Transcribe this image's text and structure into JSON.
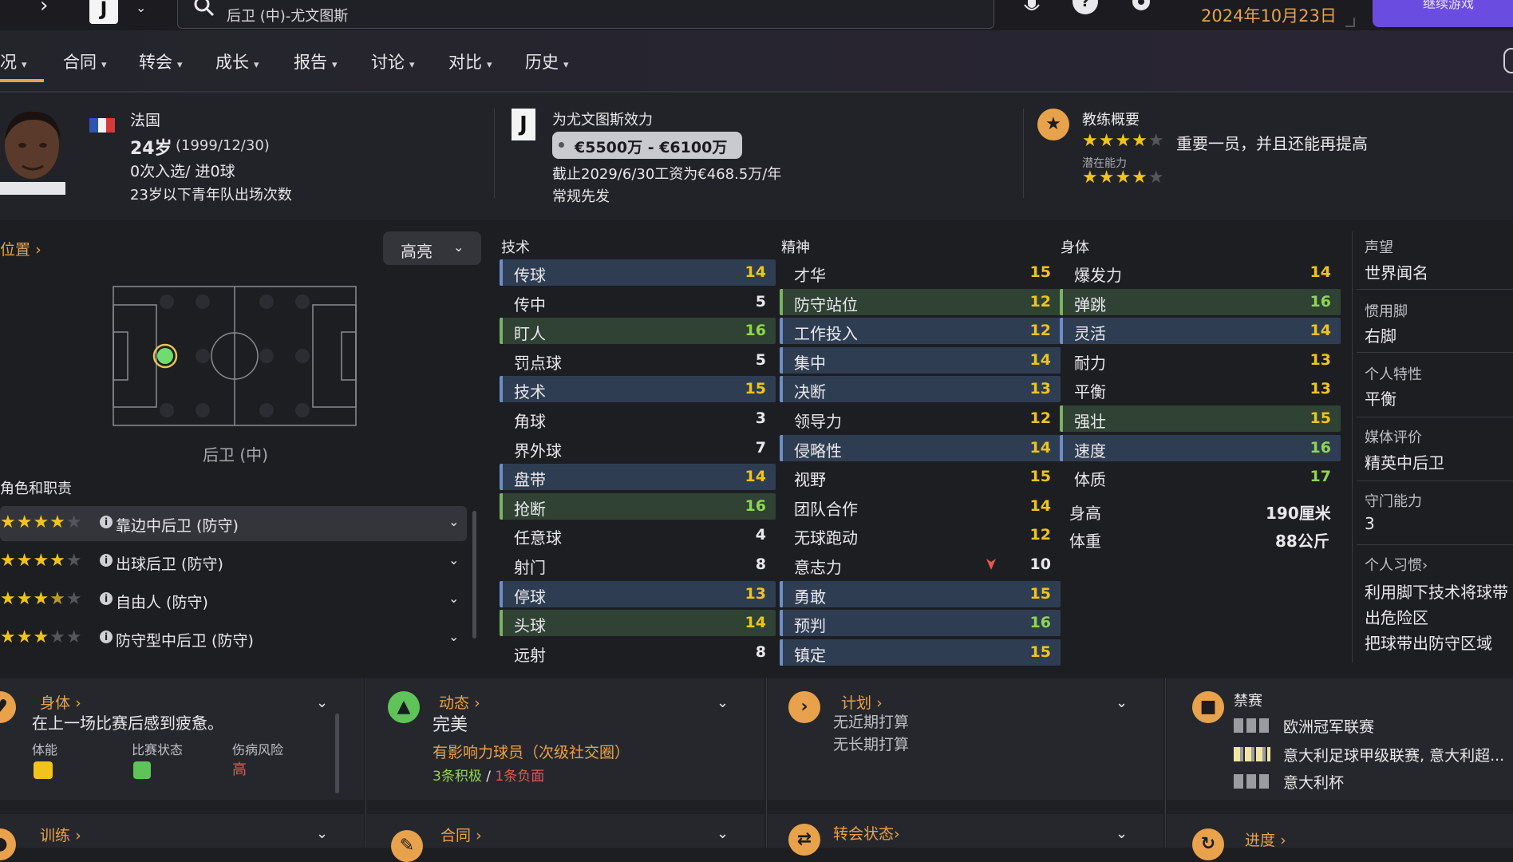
{
  "topbar": {
    "search_text": "后卫 (中)-尤文图斯",
    "date": "2024年10月23日",
    "continue_label": "继续游戏"
  },
  "nav": {
    "items": [
      "况",
      "合同",
      "转会",
      "成长",
      "报告",
      "讨论",
      "对比",
      "历史"
    ]
  },
  "header": {
    "nationality": "法国",
    "age_text": "24岁",
    "birth_date": "(1999/12/30)",
    "caps": "0次入选/ 进0球",
    "youth_caps": "23岁以下青年队出场次数",
    "club_line": "为尤文图斯效力",
    "value_range": "€5500万 - €6100万",
    "wage_line": "截止2029/6/30工资为€468.5万/年",
    "squad_status": "常规先发",
    "coach_title": "教练概要",
    "coach_summary": "重要一员，并且还能再提高",
    "potential_label": "潜在能力",
    "current_stars": 4,
    "potential_stars": 4
  },
  "position": {
    "link_label": "位置",
    "highlight_dropdown": "高亮",
    "position_name": "后卫 (中)",
    "roles_title": "角色和职责",
    "roles": [
      {
        "name": "靠边中后卫 (防守)",
        "stars": 4.0
      },
      {
        "name": "出球后卫 (防守)",
        "stars": 4.0
      },
      {
        "name": "自由人 (防守)",
        "stars": 3.5
      },
      {
        "name": "防守型中后卫 (防守)",
        "stars": 3.0
      }
    ]
  },
  "attributes": {
    "technical_title": "技术",
    "mental_title": "精神",
    "physical_title": "身体",
    "technical": [
      {
        "name": "传球",
        "value": "14",
        "hl": "blue"
      },
      {
        "name": "传中",
        "value": "5",
        "hl": "none"
      },
      {
        "name": "盯人",
        "value": "16",
        "hl": "green"
      },
      {
        "name": "罚点球",
        "value": "5",
        "hl": "none"
      },
      {
        "name": "技术",
        "value": "15",
        "hl": "blue"
      },
      {
        "name": "角球",
        "value": "3",
        "hl": "none"
      },
      {
        "name": "界外球",
        "value": "7",
        "hl": "none"
      },
      {
        "name": "盘带",
        "value": "14",
        "hl": "blue"
      },
      {
        "name": "抢断",
        "value": "16",
        "hl": "green"
      },
      {
        "name": "任意球",
        "value": "4",
        "hl": "none"
      },
      {
        "name": "射门",
        "value": "8",
        "hl": "none"
      },
      {
        "name": "停球",
        "value": "13",
        "hl": "blue"
      },
      {
        "name": "头球",
        "value": "14",
        "hl": "green"
      },
      {
        "name": "远射",
        "value": "8",
        "hl": "none"
      }
    ],
    "mental": [
      {
        "name": "才华",
        "value": "15",
        "hl": "none"
      },
      {
        "name": "防守站位",
        "value": "12",
        "hl": "green"
      },
      {
        "name": "工作投入",
        "value": "12",
        "hl": "blue"
      },
      {
        "name": "集中",
        "value": "14",
        "hl": "blue"
      },
      {
        "name": "决断",
        "value": "13",
        "hl": "blue"
      },
      {
        "name": "领导力",
        "value": "12",
        "hl": "none"
      },
      {
        "name": "侵略性",
        "value": "14",
        "hl": "blue"
      },
      {
        "name": "视野",
        "value": "15",
        "hl": "none"
      },
      {
        "name": "团队合作",
        "value": "14",
        "hl": "none"
      },
      {
        "name": "无球跑动",
        "value": "12",
        "hl": "none"
      },
      {
        "name": "意志力",
        "value": "10",
        "hl": "none"
      },
      {
        "name": "勇敢",
        "value": "15",
        "hl": "blue"
      },
      {
        "name": "预判",
        "value": "16",
        "hl": "blue"
      },
      {
        "name": "镇定",
        "value": "15",
        "hl": "blue"
      }
    ],
    "physical": [
      {
        "name": "爆发力",
        "value": "14",
        "hl": "none"
      },
      {
        "name": "弹跳",
        "value": "16",
        "hl": "green"
      },
      {
        "name": "灵活",
        "value": "14",
        "hl": "blue"
      },
      {
        "name": "耐力",
        "value": "13",
        "hl": "none"
      },
      {
        "name": "平衡",
        "value": "13",
        "hl": "none"
      },
      {
        "name": "强壮",
        "value": "15",
        "hl": "green"
      },
      {
        "name": "速度",
        "value": "16",
        "hl": "blue"
      },
      {
        "name": "体质",
        "value": "17",
        "hl": "none"
      }
    ],
    "height_label": "身高",
    "height_value": "190厘米",
    "weight_label": "体重",
    "weight_value": "88公斤"
  },
  "side": {
    "reputation_label": "声望",
    "reputation_value": "世界闻名",
    "foot_label": "惯用脚",
    "foot_value": "右脚",
    "personality_label": "个人特性",
    "personality_value": "平衡",
    "media_label": "媒体评价",
    "media_value": "精英中后卫",
    "gk_label": "守门能力",
    "gk_value": "3",
    "habits_label": "个人习惯",
    "habits": [
      "利用脚下技术将球带",
      "出危险区",
      "把球带出防守区域"
    ]
  },
  "cards": {
    "body_title": "身体",
    "body_text": "在上一场比赛后感到疲惫。",
    "stamina_label": "体能",
    "form_label": "比赛状态",
    "injury_label": "伤病风险",
    "injury_value": "高",
    "dynamic_title": "动态",
    "dynamic_value": "完美",
    "influence_text": "有影响力球员（次级社交圈）",
    "positive_count": "3条积极",
    "sep": "/",
    "negative_count": "1条负面",
    "plan_title": "计划",
    "plan_line1": "无近期打算",
    "plan_line2": "无长期打算",
    "ban_title": "禁赛",
    "ban_line1": "欧洲冠军联赛",
    "ban_line2": "意大利足球甲级联赛, 意大利超...",
    "ban_line3": "意大利杯",
    "training_title": "训练",
    "contract_title": "合同",
    "transfer_title": "转会状态",
    "progress_title": "进度"
  },
  "colors": {
    "accent": "#e8a24b",
    "value_yellow": "#f0c419",
    "value_green": "#8fd64f",
    "highlight_blue": "#2f3d52",
    "highlight_green": "#2f4234",
    "negative": "#e05a4f",
    "purple": "#6a4de0"
  },
  "icons": {
    "back": "chevron-right-icon",
    "search": "search-icon",
    "mic": "microphone-icon",
    "help": "help-icon",
    "settings": "gear-icon",
    "star": "star-icon"
  }
}
